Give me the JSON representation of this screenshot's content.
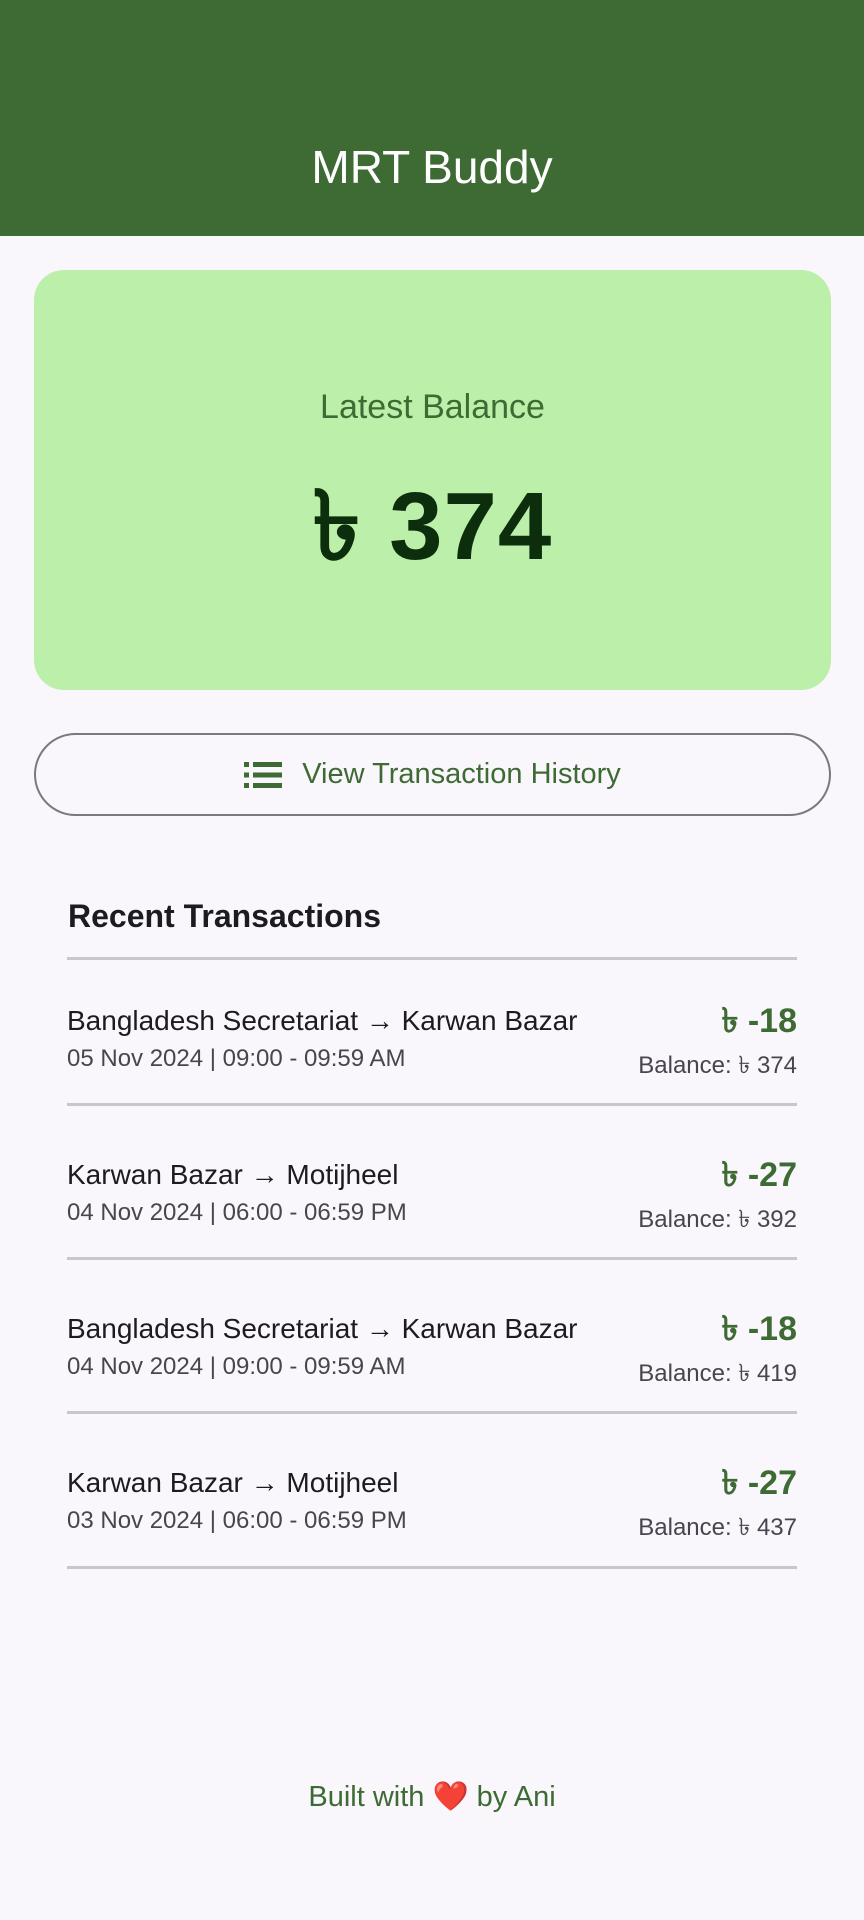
{
  "app_bar": {
    "title": "MRT Buddy",
    "color": "#3d6b33"
  },
  "balance_card": {
    "label": "Latest Balance",
    "value": "৳ 374",
    "color": "#bcf0aa"
  },
  "history_button": {
    "label": "View Transaction History",
    "icon": "list-icon"
  },
  "recent": {
    "title": "Recent Transactions",
    "transactions": [
      {
        "route": "Bangladesh Secretariat → Karwan Bazar",
        "time": "05 Nov 2024 | 09:00 - 09:59 AM",
        "amount": "৳ -18",
        "balance": "Balance: ৳ 374"
      },
      {
        "route": "Karwan Bazar → Motijheel",
        "time": "04 Nov 2024 | 06:00 - 06:59 PM",
        "amount": "৳ -27",
        "balance": "Balance: ৳ 392"
      },
      {
        "route": "Bangladesh Secretariat → Karwan Bazar",
        "time": "04 Nov 2024 | 09:00 - 09:59 AM",
        "amount": "৳ -18",
        "balance": "Balance: ৳ 419"
      },
      {
        "route": "Karwan Bazar → Motijheel",
        "time": "03 Nov 2024 | 06:00 - 06:59 PM",
        "amount": "৳ -27",
        "balance": "Balance: ৳ 437"
      }
    ]
  },
  "footer": {
    "prefix": "Built with",
    "heart": "❤️",
    "suffix": "by Ani"
  }
}
